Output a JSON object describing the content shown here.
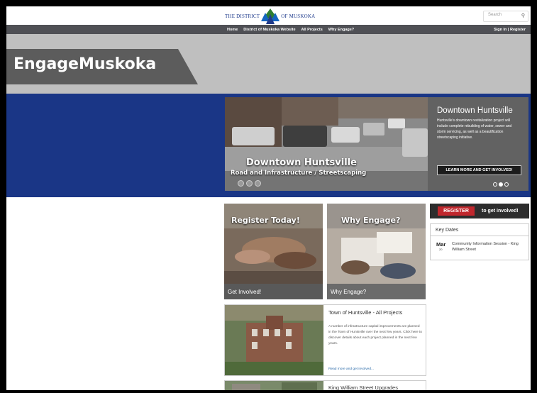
{
  "header": {
    "logo_left": "THE DISTRICT",
    "logo_right": "OF MUSKOKA",
    "search_placeholder": "Search"
  },
  "nav": {
    "links": [
      "Home",
      "District of Muskoka Website",
      "All Projects",
      "Why Engage?"
    ],
    "signin": "Sign In | Register"
  },
  "banner": {
    "title": "EngageMuskoka"
  },
  "hero": {
    "caption_title": "Downtown Huntsville",
    "caption_sub": "Road and Infrastructure / Streetscaping",
    "panel_title": "Downtown Huntsville",
    "panel_text": "Huntsville's downtown revitalization project will include complete rebuilding of water, sewer and storm servicing, as well as a beautification streetscaping initiative.",
    "panel_button": "LEARN MORE AND GET INVOLVED!"
  },
  "cards": [
    {
      "title": "Register Today!",
      "footer": "Get Involved!"
    },
    {
      "title": "Why Engage?",
      "footer": "Why Engage?"
    }
  ],
  "register": {
    "button": "REGISTER",
    "text": "to get involved!"
  },
  "key_dates": {
    "heading": "Key Dates",
    "month": "Mar",
    "day": "20",
    "event": "Community Information Session - King William Street"
  },
  "projects": [
    {
      "title": "Town of Huntsville - All Projects",
      "desc": "A number of infrastructure capital improvements are planned in the Town of Huntsville over the next few years. Click here to discover details about each project planned in the next few years.",
      "more": "Read more and get involved..."
    },
    {
      "title": "King William Street Upgrades"
    }
  ],
  "colors": {
    "nav": "#4f5055",
    "hero_band": "#1a3686",
    "banner": "#bfbfbf",
    "register_red": "#c0272d"
  }
}
